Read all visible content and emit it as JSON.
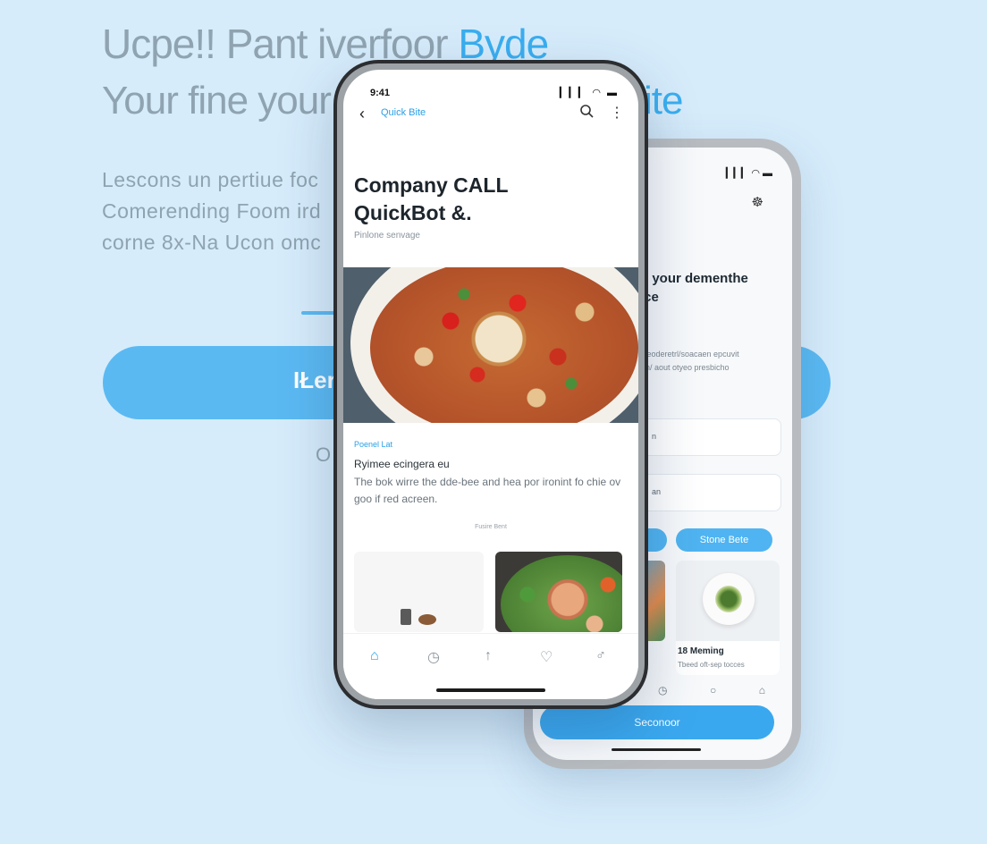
{
  "background": {
    "headline_line1": "Ucpe!! Pant iverfoor",
    "headline_line1_accent": "Byde",
    "headline_line2": "Your fine your",
    "headline_line2_accent": "ite",
    "lead_lines": [
      "Lescons un pertiue foc",
      "Comerending Foom ird",
      "corne 8x-Na Ucon omc"
    ],
    "cta_label": "IŁer",
    "or_text": "O",
    "accent_color": "#3aaef0"
  },
  "front_phone": {
    "status_time": "9:41",
    "status_icons": "▎▎▎ ◠ ▬",
    "nav": {
      "back_icon": "chevron-left-icon",
      "title": "Quick Bite",
      "search_icon": "search-icon",
      "more_icon": "more-icon"
    },
    "hero_title": "Company CALL\nQuickBot &.",
    "hero_subtitle": "Pinlone senvage",
    "card": {
      "tag": "Poenel Lat",
      "title": "Ryimee ecingera eu",
      "body": "The bok wirre the dde-bee and hea por ironint fo chie ov goo if red acreen.",
      "caption": "Fusire Bent"
    },
    "tabs": [
      {
        "icon": "home-icon",
        "glyph": "⌂",
        "active": true
      },
      {
        "icon": "clock-icon",
        "glyph": "◷",
        "active": false
      },
      {
        "icon": "thumbs-up-icon",
        "glyph": "↑",
        "active": false
      },
      {
        "icon": "heart-icon",
        "glyph": "♡",
        "active": false
      },
      {
        "icon": "profile-icon",
        "glyph": "♂",
        "active": false
      }
    ]
  },
  "back_phone": {
    "status_icons": "▎▎▎ ◠ ▬",
    "top_icon": "☸",
    "title": "n your dementhe\nice",
    "subtitle": "e eoderetrl/soacaen epcuvit\nAn/ aout otyeo presbicho",
    "field1_text": "n",
    "field2_text": "an",
    "button_label": "Stone Bete",
    "card_title": "18 Meming",
    "card_subtitle": "Tbeed oft-sep tocces",
    "nav_icons": [
      "◷",
      "○",
      "⌂"
    ],
    "bottom_button_label": "Seconoor"
  }
}
